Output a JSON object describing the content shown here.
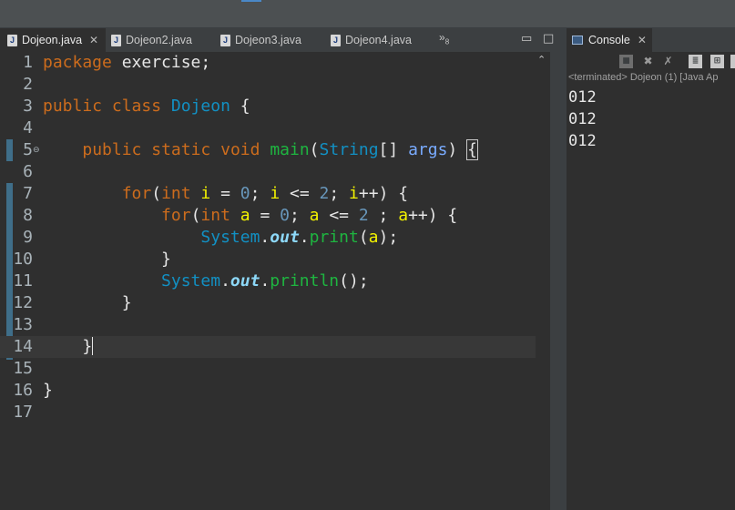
{
  "editor": {
    "tabs": [
      {
        "label": "Dojeon.java",
        "active": true
      },
      {
        "label": "Dojeon2.java",
        "active": false
      },
      {
        "label": "Dojeon3.java",
        "active": false
      },
      {
        "label": "Dojeon4.java",
        "active": false
      }
    ],
    "overflow": {
      "symbol": "»",
      "count": "8"
    },
    "line_numbers": [
      "1",
      "2",
      "3",
      "4",
      "5",
      "6",
      "7",
      "8",
      "9",
      "10",
      "11",
      "12",
      "13",
      "14",
      "15",
      "16",
      "17"
    ],
    "lines": {
      "l1": {
        "kw": "package",
        "rest": " exercise;"
      },
      "l3": {
        "kw1": "public",
        "kw2": "class",
        "cls": "Dojeon",
        "rest": " {"
      },
      "l5": {
        "indent": "    ",
        "kw1": "public",
        "kw2": "static",
        "kw3": "void",
        "meth": "main",
        "p1": "(",
        "type": "String",
        "p2": "[] ",
        "param": "args",
        "p3": ") ",
        "brace": "{"
      },
      "l7": {
        "indent": "        ",
        "kw1": "for",
        "p1": "(",
        "kw2": "int",
        "v1": "i",
        "p2": " = ",
        "n1": "0",
        "p3": "; ",
        "v2": "i",
        "p4": " <= ",
        "n2": "2",
        "p5": "; ",
        "v3": "i",
        "p6": "++) {"
      },
      "l8": {
        "indent": "            ",
        "kw1": "for",
        "p1": "(",
        "kw2": "int",
        "v1": "a",
        "p2": " = ",
        "n1": "0",
        "p3": "; ",
        "v2": "a",
        "p4": " <= ",
        "n2": "2",
        "p5": " ; ",
        "v3": "a",
        "p6": "++) {"
      },
      "l9": {
        "indent": "                ",
        "cls": "System",
        "dot1": ".",
        "fld": "out",
        "dot2": ".",
        "meth": "print",
        "p1": "(",
        "v1": "a",
        "p2": ");"
      },
      "l10": {
        "indent": "            ",
        "text": "}"
      },
      "l11": {
        "indent": "            ",
        "cls": "System",
        "dot1": ".",
        "fld": "out",
        "dot2": ".",
        "meth": "println",
        "p1": "();"
      },
      "l12": {
        "indent": "        ",
        "text": "}"
      },
      "l14": {
        "indent": "    ",
        "text": "}"
      },
      "l16": {
        "text": "}"
      }
    }
  },
  "console": {
    "tab_label": "Console",
    "status": "<terminated> Dojeon (1) [Java Ap",
    "output": [
      "012",
      "012",
      "012"
    ]
  },
  "colors": {
    "keyword": "#cc6c1d",
    "class": "#1290c3",
    "method": "#1eb540",
    "variable": "#f2f200",
    "number": "#6897bb",
    "field": "#8dd8f8",
    "background": "#2f2f2f"
  },
  "icons": [
    "java-file-icon",
    "close-icon",
    "minimize-icon",
    "maximize-icon",
    "console-icon",
    "terminate-icon",
    "remove-launch-icon",
    "remove-all-icon",
    "scroll-lock-icon",
    "pin-icon",
    "chevron-up-icon"
  ]
}
